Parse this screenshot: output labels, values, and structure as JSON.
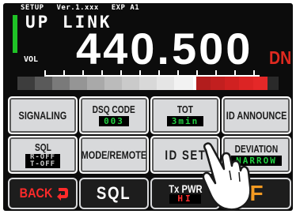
{
  "status": {
    "mode": "SETUP",
    "version": "Ver.1.xxx",
    "exp": "EXP A1"
  },
  "display": {
    "label": "UP LINK",
    "vol_label": "VOL",
    "frequency": "440.500",
    "direction": "DN"
  },
  "colors": {
    "accent_green": "#1fc226",
    "alert_red": "#e02a20",
    "f_key": "#f39a22",
    "button_face": "#d8d9db"
  },
  "softkeys": {
    "signaling": {
      "label": "SIGNALING"
    },
    "dsq_code": {
      "label": "DSQ CODE",
      "value": "003"
    },
    "tot": {
      "label": "TOT",
      "value": "3min"
    },
    "id_announce": {
      "label": "ID ANNOUNCE"
    },
    "sql": {
      "label": "SQL",
      "value_line1": "R-OFF",
      "value_line2": "T-OFF"
    },
    "mode_remote": {
      "label": "MODE/REMOTE"
    },
    "id_set": {
      "label": "ID SET"
    },
    "deviation": {
      "label": "DEVIATION",
      "value": "NARROW"
    }
  },
  "bottom": {
    "back": {
      "label": "BACK",
      "icon": "back-arrow-icon"
    },
    "sql": {
      "label": "SQL"
    },
    "tx_pwr": {
      "label": "Tx PWR",
      "value": "HI"
    },
    "f": {
      "label": "F"
    }
  },
  "pointer": {
    "icon": "touch-hand-icon"
  }
}
